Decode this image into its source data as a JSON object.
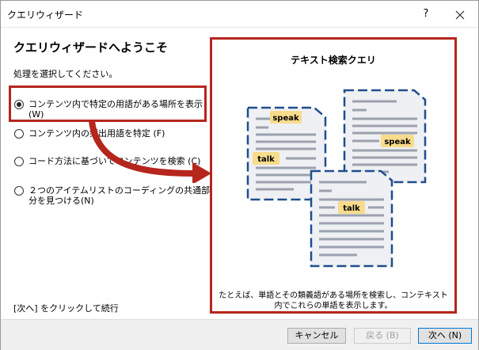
{
  "window": {
    "title": "クエリウィザード",
    "help_label": "?"
  },
  "main": {
    "heading": "クエリウィザードへようこそ",
    "instruction": "処理を選択してください。",
    "options": [
      {
        "label": "コンテンツ内で特定の用語がある場所を表示 (W)",
        "selected": true
      },
      {
        "label": "コンテンツ内の頻出用語を特定 (F)",
        "selected": false
      },
      {
        "label": "コード方法に基づいてコンテンツを検索 (C)",
        "selected": false
      },
      {
        "label": "２つのアイテムリストのコーディングの共通部分を見つける(N)",
        "selected": false
      }
    ],
    "footer_hint": "[次へ] をクリックして続行"
  },
  "panel": {
    "title": "テキスト検索クエリ",
    "tags": {
      "speak": "speak",
      "talk": "talk"
    },
    "caption": "たとえば、単語とその類義語がある場所を検索し、コンテキスト内でこれらの単語を表示します。"
  },
  "buttons": {
    "cancel": "キャンセル",
    "back": "戻る (B)",
    "next": "次へ (N)"
  },
  "colors": {
    "highlight": "#b5261d",
    "doc_border": "#1f4e8c",
    "tag_bg": "#f7dc8c"
  }
}
